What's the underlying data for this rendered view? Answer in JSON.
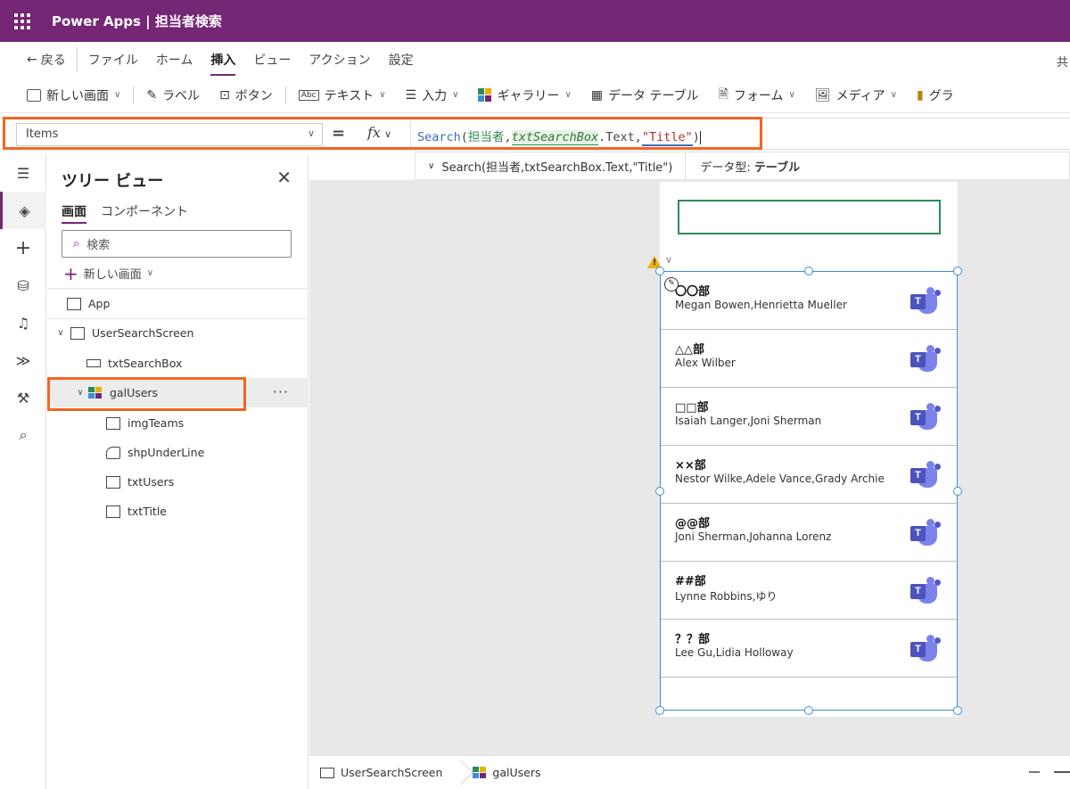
{
  "app": {
    "title": "Power Apps  |  担当者検索"
  },
  "menu": {
    "back": "戻る",
    "items": [
      "ファイル",
      "ホーム",
      "挿入",
      "ビュー",
      "アクション",
      "設定"
    ],
    "active_index": 2,
    "right_glyph": "共"
  },
  "commands": {
    "new_screen": "新しい画面",
    "label": "ラベル",
    "button": "ボタン",
    "text": "テキスト",
    "input": "入力",
    "gallery": "ギャラリー",
    "data_table": "データ テーブル",
    "form": "フォーム",
    "media": "メディア",
    "chart": "グラ"
  },
  "formula_bar": {
    "property": "Items",
    "equals": "=",
    "fx": "fx",
    "tokens": {
      "fn": "Search",
      "open": "(",
      "arg1": "担当者",
      "comma1": ",",
      "control": "txtSearchBox",
      "prop": ".Text,",
      "str": "\"Title\"",
      "close": ")"
    }
  },
  "hint": {
    "expression": "Search(担当者,txtSearchBox.Text,\"Title\")",
    "type_label": "データ型:",
    "type_value": "テーブル"
  },
  "tree": {
    "title": "ツリー ビュー",
    "tabs": [
      "画面",
      "コンポーネント"
    ],
    "search_placeholder": "検索",
    "new_screen": "新しい画面",
    "nodes": {
      "app": "App",
      "screen": "UserSearchScreen",
      "search_box": "txtSearchBox",
      "gallery": "galUsers",
      "img": "imgTeams",
      "shape": "shpUnderLine",
      "users": "txtUsers",
      "title": "txtTitle"
    },
    "more": "···"
  },
  "gallery": {
    "rows": [
      {
        "title": "〇〇部",
        "users": "Megan Bowen,Henrietta Mueller"
      },
      {
        "title": "△△部",
        "users": "Alex Wilber"
      },
      {
        "title": "□□部",
        "users": "Isaiah Langer,Joni Sherman"
      },
      {
        "title": "××部",
        "users": "Nestor Wilke,Adele Vance,Grady Archie"
      },
      {
        "title": "@@部",
        "users": "Joni Sherman,Johanna Lorenz"
      },
      {
        "title": "##部",
        "users": "Lynne Robbins,ゆり"
      },
      {
        "title": "？？部",
        "users": "Lee Gu,Lidia Holloway"
      }
    ],
    "teams_letter": "T"
  },
  "status": {
    "screen": "UserSearchScreen",
    "control": "galUsers"
  },
  "colors": {
    "brand": "#742774",
    "highlight": "#f26522",
    "selection": "#3a8fd8",
    "teams": "#7b83eb"
  }
}
